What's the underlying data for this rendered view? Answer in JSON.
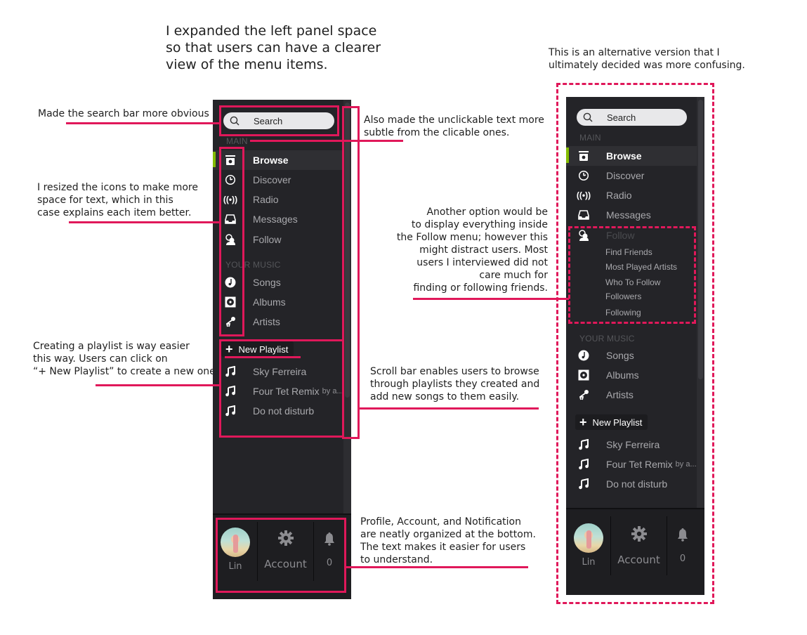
{
  "annotations": {
    "intro": "I expanded the left panel space\nso that users can have a clearer\nview of the menu items.",
    "alt_version": "This is an alternative version that I\nultimately decided was more confusing.",
    "search": "Made the search bar more obvious",
    "unclickable": "Also made the unclickable text more\nsubtle from the clicable ones.",
    "icons": "I resized the icons to make more\nspace for text, which in this\ncase explains each item better.",
    "playlist": "Creating a playlist is way easier\nthis way. Users can click on\n“+ New Playlist” to create a new one.",
    "scroll": "Scroll bar enables users to browse\nthrough playlists they created and\nadd new songs to them easily.",
    "bottom": "Profile, Account, and Notification\nare neatly organized at the bottom.\nThe text makes it easier for users\nto understand.",
    "follow_option": "Another option would be\nto display everything inside\nthe Follow menu; however this\nmight distract users. Most\nusers I interviewed did not\ncare much for\nfinding or following friends."
  },
  "colors": {
    "accent_pink": "#e0185a",
    "panel_bg": "#242428",
    "active_green": "#84bd00"
  },
  "panel": {
    "search_placeholder": "Search",
    "section_main": "MAIN",
    "section_your_music": "YOUR MUSIC",
    "main_items": [
      {
        "label": "Browse",
        "icon": "browse-icon",
        "active": true
      },
      {
        "label": "Discover",
        "icon": "discover-icon"
      },
      {
        "label": "Radio",
        "icon": "radio-icon"
      },
      {
        "label": "Messages",
        "icon": "inbox-icon"
      },
      {
        "label": "Follow",
        "icon": "follow-icon"
      }
    ],
    "music_items": [
      {
        "label": "Songs",
        "icon": "note-icon"
      },
      {
        "label": "Albums",
        "icon": "album-icon"
      },
      {
        "label": "Artists",
        "icon": "microphone-icon"
      }
    ],
    "new_playlist": "New Playlist",
    "playlists": [
      {
        "label": "Sky Ferreira",
        "sub": ""
      },
      {
        "label": "Four Tet Remix",
        "sub": "by a..."
      },
      {
        "label": "Do not disturb",
        "sub": ""
      }
    ],
    "follow_sub_items": [
      "Find Friends",
      "Most Played Artists",
      "Who To Follow",
      "Followers",
      "Following"
    ],
    "profile_name": "Lin",
    "account_label": "Account",
    "notification_count": "0"
  }
}
